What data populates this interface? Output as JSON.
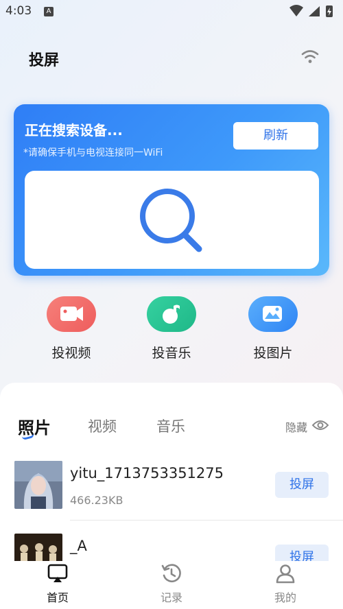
{
  "status_bar": {
    "time": "4:03",
    "notif_icon": "A"
  },
  "header": {
    "title": "投屏",
    "wifi_icon": "wifi-icon"
  },
  "search_card": {
    "status_text": "正在搜索设备...",
    "hint_text": "*请确保手机与电视连接同一WiFi",
    "refresh_label": "刷新"
  },
  "features": [
    {
      "label": "投视频",
      "icon": "video-camera-icon",
      "color": "#ee5d5d"
    },
    {
      "label": "投音乐",
      "icon": "music-note-icon",
      "color": "#1fb888"
    },
    {
      "label": "投图片",
      "icon": "image-icon",
      "color": "#2f85f4"
    }
  ],
  "media_panel": {
    "tabs": [
      {
        "label": "照片",
        "active": true
      },
      {
        "label": "视频",
        "active": false
      },
      {
        "label": "音乐",
        "active": false
      }
    ],
    "hide_label": "隐藏",
    "items": [
      {
        "name": "yitu_1713753351275",
        "size": "466.23KB",
        "action": "投屏"
      },
      {
        "name": "_A",
        "size": "",
        "action": "投屏"
      }
    ]
  },
  "bottom_nav": [
    {
      "label": "首页",
      "icon": "cast-screen-icon",
      "active": true
    },
    {
      "label": "记录",
      "icon": "history-icon",
      "active": false
    },
    {
      "label": "我的",
      "icon": "user-icon",
      "active": false
    }
  ],
  "colors": {
    "accent": "#2f73e8",
    "card_gradient_start": "#2f7ef6",
    "card_gradient_end": "#5ab8fb"
  }
}
